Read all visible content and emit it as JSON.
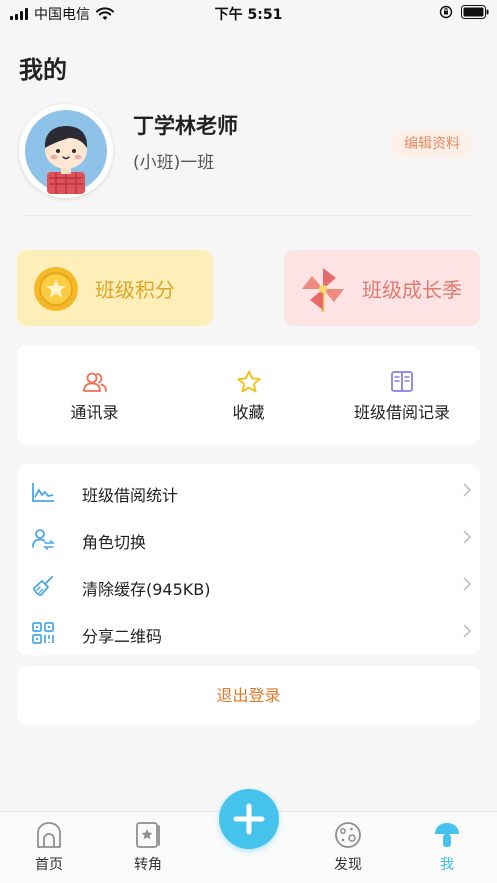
{
  "status_bar": {
    "carrier": "中国电信",
    "time": "下午 5:51"
  },
  "page": {
    "title": "我的"
  },
  "profile": {
    "name": "丁学林老师",
    "class_name": "(小班)一班",
    "edit_label": "编辑资料"
  },
  "feature_cards": [
    {
      "label": "班级积分",
      "icon": "gold-coin-star-icon"
    },
    {
      "label": "班级成长季",
      "icon": "pinwheel-icon"
    }
  ],
  "quick_actions": [
    {
      "label": "通讯录",
      "icon": "contacts-icon"
    },
    {
      "label": "收藏",
      "icon": "star-icon"
    },
    {
      "label": "班级借阅记录",
      "icon": "open-book-icon"
    }
  ],
  "menu": [
    {
      "label": "班级借阅统计",
      "icon": "line-chart-icon"
    },
    {
      "label": "角色切换",
      "icon": "user-switch-icon"
    },
    {
      "label": "清除缓存(945KB)",
      "icon": "broom-icon"
    },
    {
      "label": "分享二维码",
      "icon": "qr-code-icon"
    }
  ],
  "logout_label": "退出登录",
  "tabbar": {
    "items": [
      {
        "label": "首页",
        "icon": "home-icon"
      },
      {
        "label": "转角",
        "icon": "star-card-icon"
      },
      {
        "label": "发现",
        "icon": "planet-icon"
      },
      {
        "label": "我",
        "icon": "mushroom-icon"
      }
    ],
    "active_index": 3,
    "center_button_icon": "plus-icon"
  },
  "colors": {
    "accent": "#45c3ec",
    "logout_text": "#e07a2a",
    "points_card_bg": "#fdefb7",
    "season_card_bg": "#fde3e3"
  }
}
